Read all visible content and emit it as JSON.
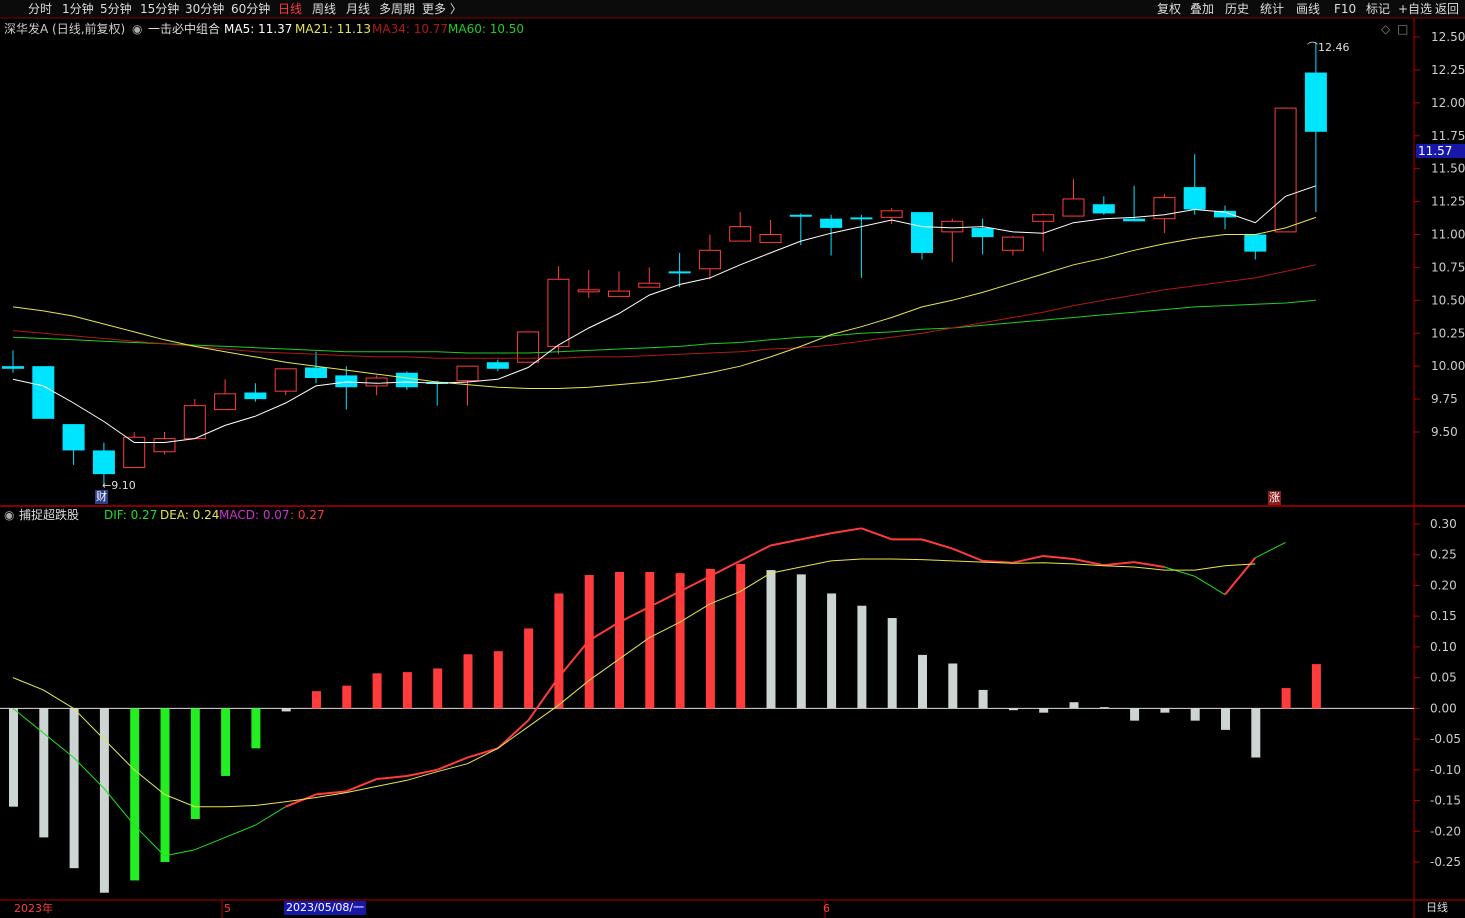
{
  "toolbar": {
    "left": [
      "分时",
      "1分钟",
      "5分钟",
      "15分钟",
      "30分钟",
      "60分钟",
      "日线",
      "周线",
      "月线",
      "多周期",
      "更多 〉"
    ],
    "right": [
      "复权",
      "叠加",
      "历史",
      "统计",
      "画线",
      "F10",
      "标记",
      "+自选",
      "返回"
    ]
  },
  "main_info": {
    "stock": "深华发A (日线,前复权)",
    "indicator": "一击必中组合",
    "ma5": "MA5: 11.37",
    "ma21": "MA21: 11.13",
    "ma34": "MA34: 10.77",
    "ma60": "MA60: 10.50"
  },
  "sub_info": {
    "name": "捕捉超跌股",
    "dif": "DIF: 0.27",
    "dea": "DEA: 0.24",
    "macd": "MACD: 0.07",
    "macd_val": "0.27"
  },
  "markers": {
    "low": "9.10",
    "high": "12.46",
    "cai": "财",
    "zhang": "涨",
    "current_price": "11.57"
  },
  "bottom": {
    "year": "2023年",
    "m5": "5",
    "date": "2023/05/08/一",
    "m6": "6",
    "period": "日线"
  },
  "colors": {
    "up": "#ff3b3b",
    "down": "#00e5ff",
    "ma5": "#ffffff",
    "ma21": "#e6e651",
    "ma34": "#b01818",
    "ma60": "#22cc22",
    "dif": "#22dd22",
    "dea": "#e6e651",
    "macd": "#cc33cc",
    "grid": "#7a0000"
  },
  "chart_data": {
    "type": "candlestick",
    "price_ylim": [
      9.1,
      12.6
    ],
    "price_ticks": [
      "12.50",
      "12.25",
      "12.00",
      "11.75",
      "11.50",
      "11.25",
      "11.00",
      "10.75",
      "10.50",
      "10.25",
      "10.00",
      "9.75",
      "9.50"
    ],
    "candles": [
      {
        "o": 10.0,
        "c": 9.98,
        "h": 10.12,
        "l": 9.95
      },
      {
        "o": 10.0,
        "c": 9.6,
        "h": 10.0,
        "l": 9.6
      },
      {
        "o": 9.56,
        "c": 9.36,
        "h": 9.56,
        "l": 9.25
      },
      {
        "o": 9.36,
        "c": 9.18,
        "h": 9.42,
        "l": 9.1
      },
      {
        "o": 9.23,
        "c": 9.46,
        "h": 9.5,
        "l": 9.23
      },
      {
        "o": 9.35,
        "c": 9.45,
        "h": 9.5,
        "l": 9.33
      },
      {
        "o": 9.45,
        "c": 9.7,
        "h": 9.75,
        "l": 9.45
      },
      {
        "o": 9.67,
        "c": 9.79,
        "h": 9.9,
        "l": 9.67
      },
      {
        "o": 9.8,
        "c": 9.75,
        "h": 9.87,
        "l": 9.73
      },
      {
        "o": 9.81,
        "c": 9.98,
        "h": 9.98,
        "l": 9.78
      },
      {
        "o": 9.99,
        "c": 9.91,
        "h": 10.11,
        "l": 9.87
      },
      {
        "o": 9.93,
        "c": 9.84,
        "h": 10.0,
        "l": 9.67
      },
      {
        "o": 9.85,
        "c": 9.91,
        "h": 9.93,
        "l": 9.78
      },
      {
        "o": 9.95,
        "c": 9.84,
        "h": 9.96,
        "l": 9.82
      },
      {
        "o": 9.88,
        "c": 9.87,
        "h": 9.89,
        "l": 9.7
      },
      {
        "o": 9.89,
        "c": 10.0,
        "h": 10.0,
        "l": 9.7
      },
      {
        "o": 10.03,
        "c": 9.98,
        "h": 10.05,
        "l": 9.96
      },
      {
        "o": 10.03,
        "c": 10.26,
        "h": 10.26,
        "l": 10.03
      },
      {
        "o": 10.15,
        "c": 10.66,
        "h": 10.76,
        "l": 10.09
      },
      {
        "o": 10.57,
        "c": 10.58,
        "h": 10.73,
        "l": 10.52
      },
      {
        "o": 10.53,
        "c": 10.57,
        "h": 10.72,
        "l": 10.53
      },
      {
        "o": 10.6,
        "c": 10.63,
        "h": 10.75,
        "l": 10.6
      },
      {
        "o": 10.72,
        "c": 10.71,
        "h": 10.86,
        "l": 10.6
      },
      {
        "o": 10.74,
        "c": 10.88,
        "h": 11.0,
        "l": 10.66
      },
      {
        "o": 10.95,
        "c": 11.06,
        "h": 11.17,
        "l": 10.95
      },
      {
        "o": 10.94,
        "c": 11.0,
        "h": 11.11,
        "l": 10.94
      },
      {
        "o": 11.15,
        "c": 11.14,
        "h": 11.16,
        "l": 10.92
      },
      {
        "o": 11.12,
        "c": 11.05,
        "h": 11.15,
        "l": 10.84
      },
      {
        "o": 11.13,
        "c": 11.12,
        "h": 11.15,
        "l": 10.67
      },
      {
        "o": 11.13,
        "c": 11.18,
        "h": 11.2,
        "l": 11.08
      },
      {
        "o": 11.17,
        "c": 10.86,
        "h": 11.17,
        "l": 10.81
      },
      {
        "o": 11.02,
        "c": 11.1,
        "h": 11.12,
        "l": 10.79
      },
      {
        "o": 11.05,
        "c": 10.98,
        "h": 11.12,
        "l": 10.85
      },
      {
        "o": 10.88,
        "c": 10.98,
        "h": 10.99,
        "l": 10.84
      },
      {
        "o": 11.1,
        "c": 11.15,
        "h": 11.16,
        "l": 10.87
      },
      {
        "o": 11.14,
        "c": 11.27,
        "h": 11.42,
        "l": 11.14
      },
      {
        "o": 11.23,
        "c": 11.16,
        "h": 11.29,
        "l": 11.15
      },
      {
        "o": 11.12,
        "c": 11.1,
        "h": 11.37,
        "l": 11.1
      },
      {
        "o": 11.12,
        "c": 11.28,
        "h": 11.31,
        "l": 11.01
      },
      {
        "o": 11.36,
        "c": 11.19,
        "h": 11.61,
        "l": 11.15
      },
      {
        "o": 11.18,
        "c": 11.13,
        "h": 11.22,
        "l": 11.04
      },
      {
        "o": 11.0,
        "c": 10.87,
        "h": 11.0,
        "l": 10.81
      },
      {
        "o": 11.02,
        "c": 11.96,
        "h": 11.96,
        "l": 11.02
      },
      {
        "o": 12.23,
        "c": 11.78,
        "h": 12.46,
        "l": 11.17
      }
    ],
    "ma5": [
      9.9,
      9.85,
      9.72,
      9.58,
      9.42,
      9.42,
      9.45,
      9.55,
      9.62,
      9.72,
      9.85,
      9.88,
      9.87,
      9.88,
      9.87,
      9.88,
      9.9,
      9.99,
      10.16,
      10.29,
      10.4,
      10.54,
      10.62,
      10.67,
      10.77,
      10.86,
      10.95,
      11.01,
      11.06,
      11.11,
      11.06,
      11.05,
      11.06,
      11.02,
      11.01,
      11.09,
      11.12,
      11.13,
      11.15,
      11.19,
      11.17,
      11.09,
      11.29,
      11.37
    ],
    "ma21": [
      10.45,
      10.42,
      10.38,
      10.32,
      10.26,
      10.2,
      10.15,
      10.11,
      10.07,
      10.03,
      10.0,
      9.97,
      9.94,
      9.91,
      9.88,
      9.86,
      9.84,
      9.83,
      9.83,
      9.84,
      9.86,
      9.88,
      9.91,
      9.95,
      10.0,
      10.07,
      10.15,
      10.24,
      10.3,
      10.37,
      10.45,
      10.5,
      10.56,
      10.63,
      10.7,
      10.77,
      10.82,
      10.88,
      10.93,
      10.97,
      11.0,
      11.0,
      11.05,
      11.13
    ],
    "ma34": [
      10.27,
      10.25,
      10.23,
      10.21,
      10.19,
      10.17,
      10.15,
      10.13,
      10.11,
      10.1,
      10.09,
      10.08,
      10.07,
      10.07,
      10.06,
      10.06,
      10.06,
      10.06,
      10.06,
      10.07,
      10.07,
      10.08,
      10.09,
      10.1,
      10.11,
      10.13,
      10.14,
      10.16,
      10.19,
      10.22,
      10.25,
      10.29,
      10.33,
      10.37,
      10.41,
      10.46,
      10.5,
      10.54,
      10.58,
      10.61,
      10.64,
      10.67,
      10.72,
      10.77
    ],
    "ma60": [
      10.22,
      10.21,
      10.2,
      10.19,
      10.18,
      10.17,
      10.16,
      10.15,
      10.14,
      10.13,
      10.12,
      10.11,
      10.11,
      10.11,
      10.11,
      10.1,
      10.1,
      10.1,
      10.11,
      10.12,
      10.13,
      10.14,
      10.15,
      10.17,
      10.18,
      10.2,
      10.22,
      10.23,
      10.25,
      10.26,
      10.28,
      10.29,
      10.31,
      10.33,
      10.35,
      10.37,
      10.39,
      10.41,
      10.43,
      10.45,
      10.46,
      10.47,
      10.48,
      10.5
    ],
    "macd_ylim": [
      -0.3,
      0.32
    ],
    "macd_ticks": [
      "0.30",
      "0.25",
      "0.20",
      "0.15",
      "0.10",
      "0.05",
      "0.00",
      "-0.05",
      "-0.10",
      "-0.15",
      "-0.20",
      "-0.25"
    ],
    "macd_bars": [
      -0.16,
      -0.21,
      -0.26,
      -0.3,
      -0.28,
      -0.25,
      -0.18,
      -0.11,
      -0.065,
      -0.005,
      0.028,
      0.037,
      0.057,
      0.059,
      0.065,
      0.088,
      0.093,
      0.13,
      0.187,
      0.217,
      0.222,
      0.222,
      0.22,
      0.227,
      0.235,
      0.225,
      0.218,
      0.187,
      0.167,
      0.147,
      0.087,
      0.073,
      0.03,
      -0.003,
      -0.007,
      0.01,
      0.002,
      -0.02,
      -0.007,
      -0.02,
      -0.035,
      -0.08,
      0.033,
      0.072
    ],
    "dif": [
      0.0,
      -0.04,
      -0.08,
      -0.13,
      -0.19,
      -0.24,
      -0.23,
      -0.21,
      -0.19,
      -0.16,
      -0.14,
      -0.135,
      -0.115,
      -0.11,
      -0.1,
      -0.08,
      -0.065,
      -0.02,
      0.05,
      0.11,
      0.14,
      0.165,
      0.19,
      0.215,
      0.24,
      0.265,
      0.275,
      0.285,
      0.293,
      0.275,
      0.275,
      0.26,
      0.24,
      0.237,
      0.248,
      0.243,
      0.233,
      0.238,
      0.23,
      0.215,
      0.185,
      0.245,
      0.27
    ],
    "dea": [
      0.05,
      0.03,
      0.0,
      -0.05,
      -0.1,
      -0.14,
      -0.16,
      -0.16,
      -0.158,
      -0.152,
      -0.145,
      -0.137,
      -0.127,
      -0.117,
      -0.103,
      -0.09,
      -0.065,
      -0.03,
      0.005,
      0.045,
      0.08,
      0.115,
      0.14,
      0.17,
      0.19,
      0.22,
      0.23,
      0.24,
      0.243,
      0.243,
      0.242,
      0.24,
      0.238,
      0.236,
      0.237,
      0.235,
      0.232,
      0.23,
      0.225,
      0.225,
      0.232,
      0.235
    ]
  }
}
